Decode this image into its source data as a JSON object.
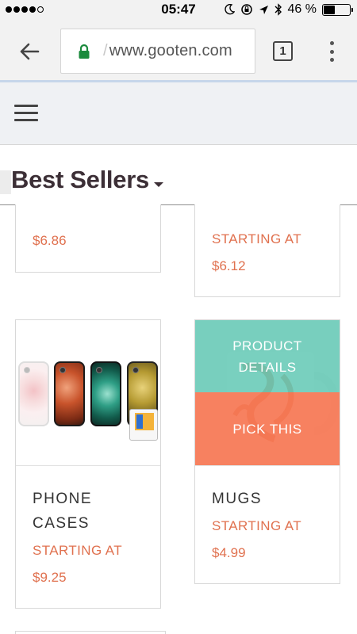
{
  "status_bar": {
    "time": "05:47",
    "battery_percent": "46 %",
    "battery_level": 0.46
  },
  "browser": {
    "url": "www.gooten.com",
    "tab_count": "1"
  },
  "section": {
    "title": "Best Sellers"
  },
  "products": {
    "partial_left": {
      "price": "$6.86"
    },
    "partial_right": {
      "starting_label": "STARTING AT",
      "price": "$6.12"
    },
    "phone_cases": {
      "name_line1": "PHONE",
      "name_line2": "CASES",
      "starting_label": "STARTING AT",
      "price": "$9.25"
    },
    "mugs": {
      "name": "MUGS",
      "starting_label": "STARTING AT",
      "price": "$4.99",
      "overlay_details_line1": "PRODUCT",
      "overlay_details_line2": "DETAILS",
      "overlay_pick": "PICK THIS"
    }
  },
  "colors": {
    "accent_orange": "#e0714f",
    "overlay_teal": "#62c8b4",
    "overlay_orange": "#f67652",
    "title_color": "#3c2f36"
  }
}
